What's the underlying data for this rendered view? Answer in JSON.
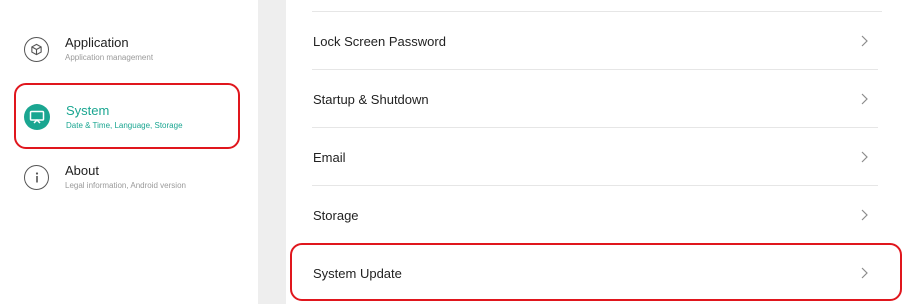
{
  "sidebar": {
    "items": [
      {
        "title": "Application",
        "subtitle": "Application management",
        "icon": "cube-icon",
        "active": false
      },
      {
        "title": "System",
        "subtitle": "Date & Time, Language, Storage",
        "icon": "monitor-icon",
        "active": true
      },
      {
        "title": "About",
        "subtitle": "Legal information, Android version",
        "icon": "info-icon",
        "active": false
      }
    ]
  },
  "settings": {
    "rows": [
      {
        "label": "Lock Screen Password"
      },
      {
        "label": "Startup & Shutdown"
      },
      {
        "label": "Email"
      },
      {
        "label": "Storage"
      },
      {
        "label": "System Update"
      }
    ]
  },
  "colors": {
    "accent": "#1aa691",
    "highlight": "#e0161d",
    "divider": "#eeeeee"
  }
}
